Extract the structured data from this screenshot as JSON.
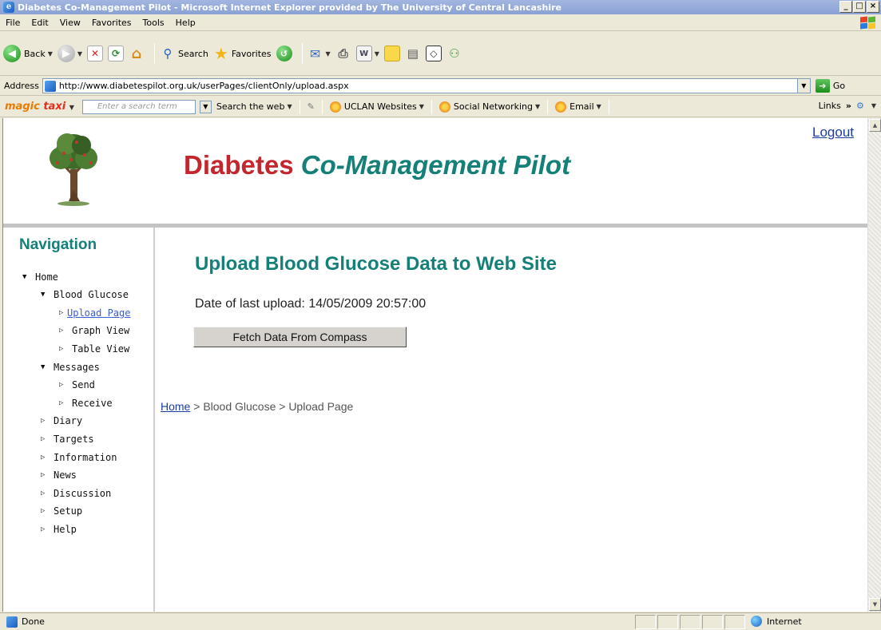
{
  "window": {
    "title": "Diabetes Co-Management Pilot - Microsoft Internet Explorer provided by The University of Central Lancashire"
  },
  "menu": [
    "File",
    "Edit",
    "View",
    "Favorites",
    "Tools",
    "Help"
  ],
  "toolbar": {
    "back": "Back",
    "search": "Search",
    "favorites": "Favorites"
  },
  "address": {
    "label": "Address",
    "url": "http://www.diabetespilot.org.uk/userPages/clientOnly/upload.aspx",
    "go": "Go"
  },
  "links": {
    "brand_a": "magic",
    "brand_b": "taxi",
    "search_placeholder": "Enter a search term",
    "search_web": "Search the web",
    "uclan": "UCLAN Websites",
    "social": "Social Networking",
    "email": "Email",
    "links_label": "Links"
  },
  "header": {
    "logout": "Logout",
    "title_a": "Diabetes",
    "title_b": "Co-Management Pilot"
  },
  "nav": {
    "title": "Navigation",
    "items": [
      {
        "label": "Home"
      },
      {
        "label": "Blood Glucose"
      },
      {
        "label": "Upload Page"
      },
      {
        "label": "Graph View"
      },
      {
        "label": "Table View"
      },
      {
        "label": "Messages"
      },
      {
        "label": "Send"
      },
      {
        "label": "Receive"
      },
      {
        "label": "Diary"
      },
      {
        "label": "Targets"
      },
      {
        "label": "Information"
      },
      {
        "label": "News"
      },
      {
        "label": "Discussion"
      },
      {
        "label": "Setup"
      },
      {
        "label": "Help"
      }
    ]
  },
  "main": {
    "title": "Upload Blood Glucose Data to Web Site",
    "last_upload": "Date of last upload: 14/05/2009 20:57:00",
    "fetch_button": "Fetch Data From Compass"
  },
  "breadcrumb": {
    "home": "Home",
    "rest": " > Blood Glucose > Upload Page"
  },
  "status": {
    "text": "Done",
    "zone": "Internet"
  }
}
